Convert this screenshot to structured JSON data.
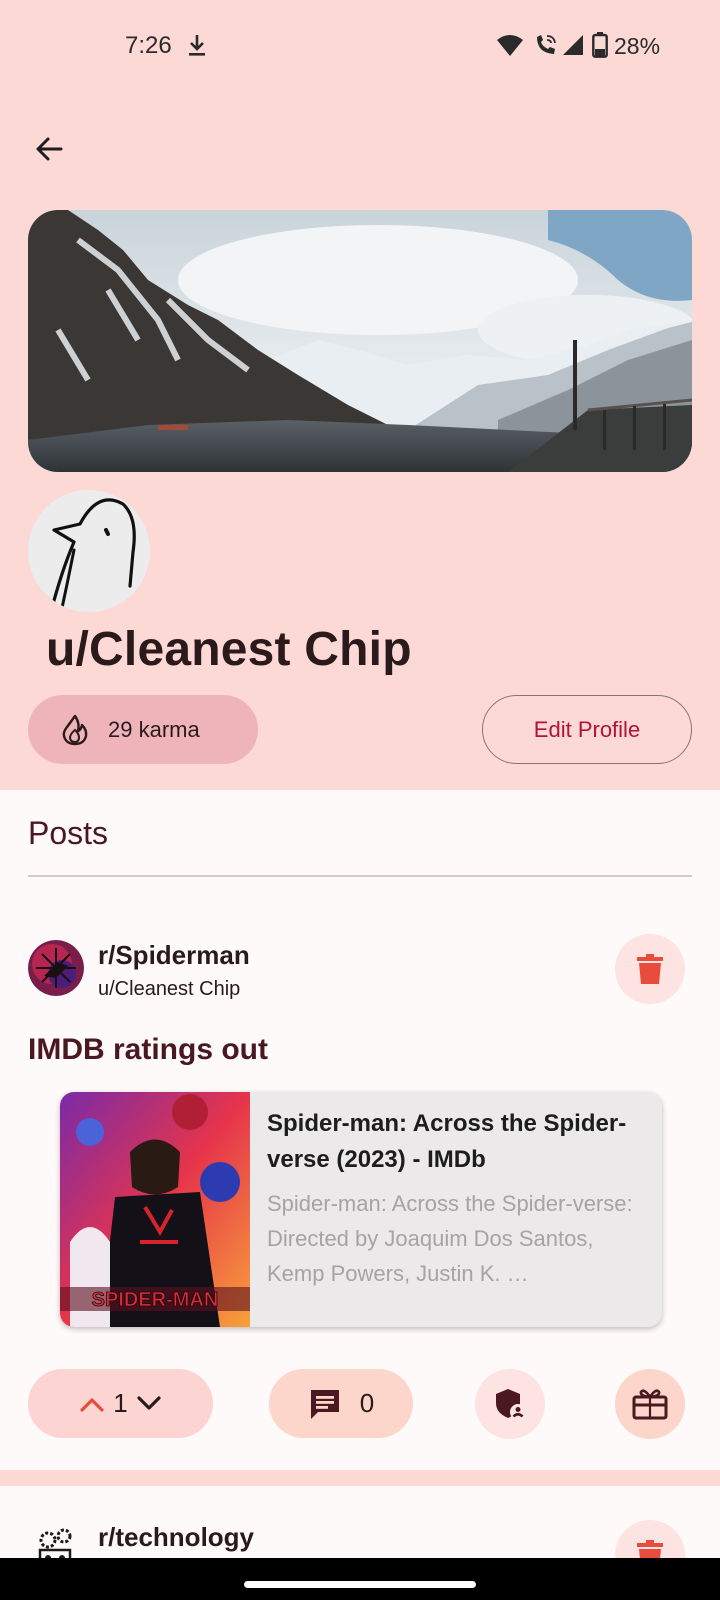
{
  "status_bar": {
    "time": "7:26",
    "battery": "28%",
    "icons": [
      "download-icon",
      "wifi-icon",
      "wifi-call-icon",
      "signal-icon",
      "battery-icon"
    ]
  },
  "colors": {
    "header_bg": "#fdd9d6",
    "accent": "#b3123a",
    "karma_chip": "#eeb4b9",
    "delete_icon": "#e84c3d"
  },
  "profile": {
    "username": "u/Cleanest Chip",
    "karma": "29 karma",
    "edit_label": "Edit Profile"
  },
  "posts_section": {
    "heading": "Posts"
  },
  "posts": [
    {
      "subreddit": "r/Spiderman",
      "author": "u/Cleanest Chip",
      "title": "IMDB ratings out",
      "link": {
        "title": "Spider-man: Across the Spider-verse (2023) - IMDb",
        "description": "Spider-man: Across the Spider-verse: Directed by Joaquim Dos Santos, Kemp Powers, Justin K. …",
        "poster_text": "SPIDER-MAN"
      },
      "score": "1",
      "comments": "0"
    },
    {
      "subreddit": "r/technology"
    }
  ]
}
